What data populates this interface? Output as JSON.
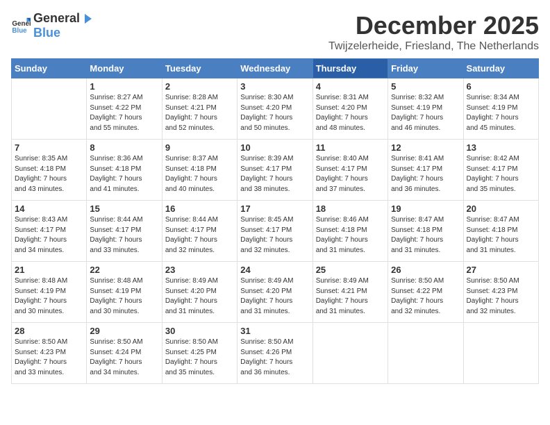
{
  "logo": {
    "general": "General",
    "blue": "Blue"
  },
  "title": "December 2025",
  "location": "Twijzelerheide, Friesland, The Netherlands",
  "days_of_week": [
    "Sunday",
    "Monday",
    "Tuesday",
    "Wednesday",
    "Thursday",
    "Friday",
    "Saturday"
  ],
  "weeks": [
    [
      {
        "day": "",
        "info": ""
      },
      {
        "day": "1",
        "info": "Sunrise: 8:27 AM\nSunset: 4:22 PM\nDaylight: 7 hours\nand 55 minutes."
      },
      {
        "day": "2",
        "info": "Sunrise: 8:28 AM\nSunset: 4:21 PM\nDaylight: 7 hours\nand 52 minutes."
      },
      {
        "day": "3",
        "info": "Sunrise: 8:30 AM\nSunset: 4:20 PM\nDaylight: 7 hours\nand 50 minutes."
      },
      {
        "day": "4",
        "info": "Sunrise: 8:31 AM\nSunset: 4:20 PM\nDaylight: 7 hours\nand 48 minutes."
      },
      {
        "day": "5",
        "info": "Sunrise: 8:32 AM\nSunset: 4:19 PM\nDaylight: 7 hours\nand 46 minutes."
      },
      {
        "day": "6",
        "info": "Sunrise: 8:34 AM\nSunset: 4:19 PM\nDaylight: 7 hours\nand 45 minutes."
      }
    ],
    [
      {
        "day": "7",
        "info": "Sunrise: 8:35 AM\nSunset: 4:18 PM\nDaylight: 7 hours\nand 43 minutes."
      },
      {
        "day": "8",
        "info": "Sunrise: 8:36 AM\nSunset: 4:18 PM\nDaylight: 7 hours\nand 41 minutes."
      },
      {
        "day": "9",
        "info": "Sunrise: 8:37 AM\nSunset: 4:18 PM\nDaylight: 7 hours\nand 40 minutes."
      },
      {
        "day": "10",
        "info": "Sunrise: 8:39 AM\nSunset: 4:17 PM\nDaylight: 7 hours\nand 38 minutes."
      },
      {
        "day": "11",
        "info": "Sunrise: 8:40 AM\nSunset: 4:17 PM\nDaylight: 7 hours\nand 37 minutes."
      },
      {
        "day": "12",
        "info": "Sunrise: 8:41 AM\nSunset: 4:17 PM\nDaylight: 7 hours\nand 36 minutes."
      },
      {
        "day": "13",
        "info": "Sunrise: 8:42 AM\nSunset: 4:17 PM\nDaylight: 7 hours\nand 35 minutes."
      }
    ],
    [
      {
        "day": "14",
        "info": "Sunrise: 8:43 AM\nSunset: 4:17 PM\nDaylight: 7 hours\nand 34 minutes."
      },
      {
        "day": "15",
        "info": "Sunrise: 8:44 AM\nSunset: 4:17 PM\nDaylight: 7 hours\nand 33 minutes."
      },
      {
        "day": "16",
        "info": "Sunrise: 8:44 AM\nSunset: 4:17 PM\nDaylight: 7 hours\nand 32 minutes."
      },
      {
        "day": "17",
        "info": "Sunrise: 8:45 AM\nSunset: 4:17 PM\nDaylight: 7 hours\nand 32 minutes."
      },
      {
        "day": "18",
        "info": "Sunrise: 8:46 AM\nSunset: 4:18 PM\nDaylight: 7 hours\nand 31 minutes."
      },
      {
        "day": "19",
        "info": "Sunrise: 8:47 AM\nSunset: 4:18 PM\nDaylight: 7 hours\nand 31 minutes."
      },
      {
        "day": "20",
        "info": "Sunrise: 8:47 AM\nSunset: 4:18 PM\nDaylight: 7 hours\nand 31 minutes."
      }
    ],
    [
      {
        "day": "21",
        "info": "Sunrise: 8:48 AM\nSunset: 4:19 PM\nDaylight: 7 hours\nand 30 minutes."
      },
      {
        "day": "22",
        "info": "Sunrise: 8:48 AM\nSunset: 4:19 PM\nDaylight: 7 hours\nand 30 minutes."
      },
      {
        "day": "23",
        "info": "Sunrise: 8:49 AM\nSunset: 4:20 PM\nDaylight: 7 hours\nand 31 minutes."
      },
      {
        "day": "24",
        "info": "Sunrise: 8:49 AM\nSunset: 4:20 PM\nDaylight: 7 hours\nand 31 minutes."
      },
      {
        "day": "25",
        "info": "Sunrise: 8:49 AM\nSunset: 4:21 PM\nDaylight: 7 hours\nand 31 minutes."
      },
      {
        "day": "26",
        "info": "Sunrise: 8:50 AM\nSunset: 4:22 PM\nDaylight: 7 hours\nand 32 minutes."
      },
      {
        "day": "27",
        "info": "Sunrise: 8:50 AM\nSunset: 4:23 PM\nDaylight: 7 hours\nand 32 minutes."
      }
    ],
    [
      {
        "day": "28",
        "info": "Sunrise: 8:50 AM\nSunset: 4:23 PM\nDaylight: 7 hours\nand 33 minutes."
      },
      {
        "day": "29",
        "info": "Sunrise: 8:50 AM\nSunset: 4:24 PM\nDaylight: 7 hours\nand 34 minutes."
      },
      {
        "day": "30",
        "info": "Sunrise: 8:50 AM\nSunset: 4:25 PM\nDaylight: 7 hours\nand 35 minutes."
      },
      {
        "day": "31",
        "info": "Sunrise: 8:50 AM\nSunset: 4:26 PM\nDaylight: 7 hours\nand 36 minutes."
      },
      {
        "day": "",
        "info": ""
      },
      {
        "day": "",
        "info": ""
      },
      {
        "day": "",
        "info": ""
      }
    ]
  ]
}
